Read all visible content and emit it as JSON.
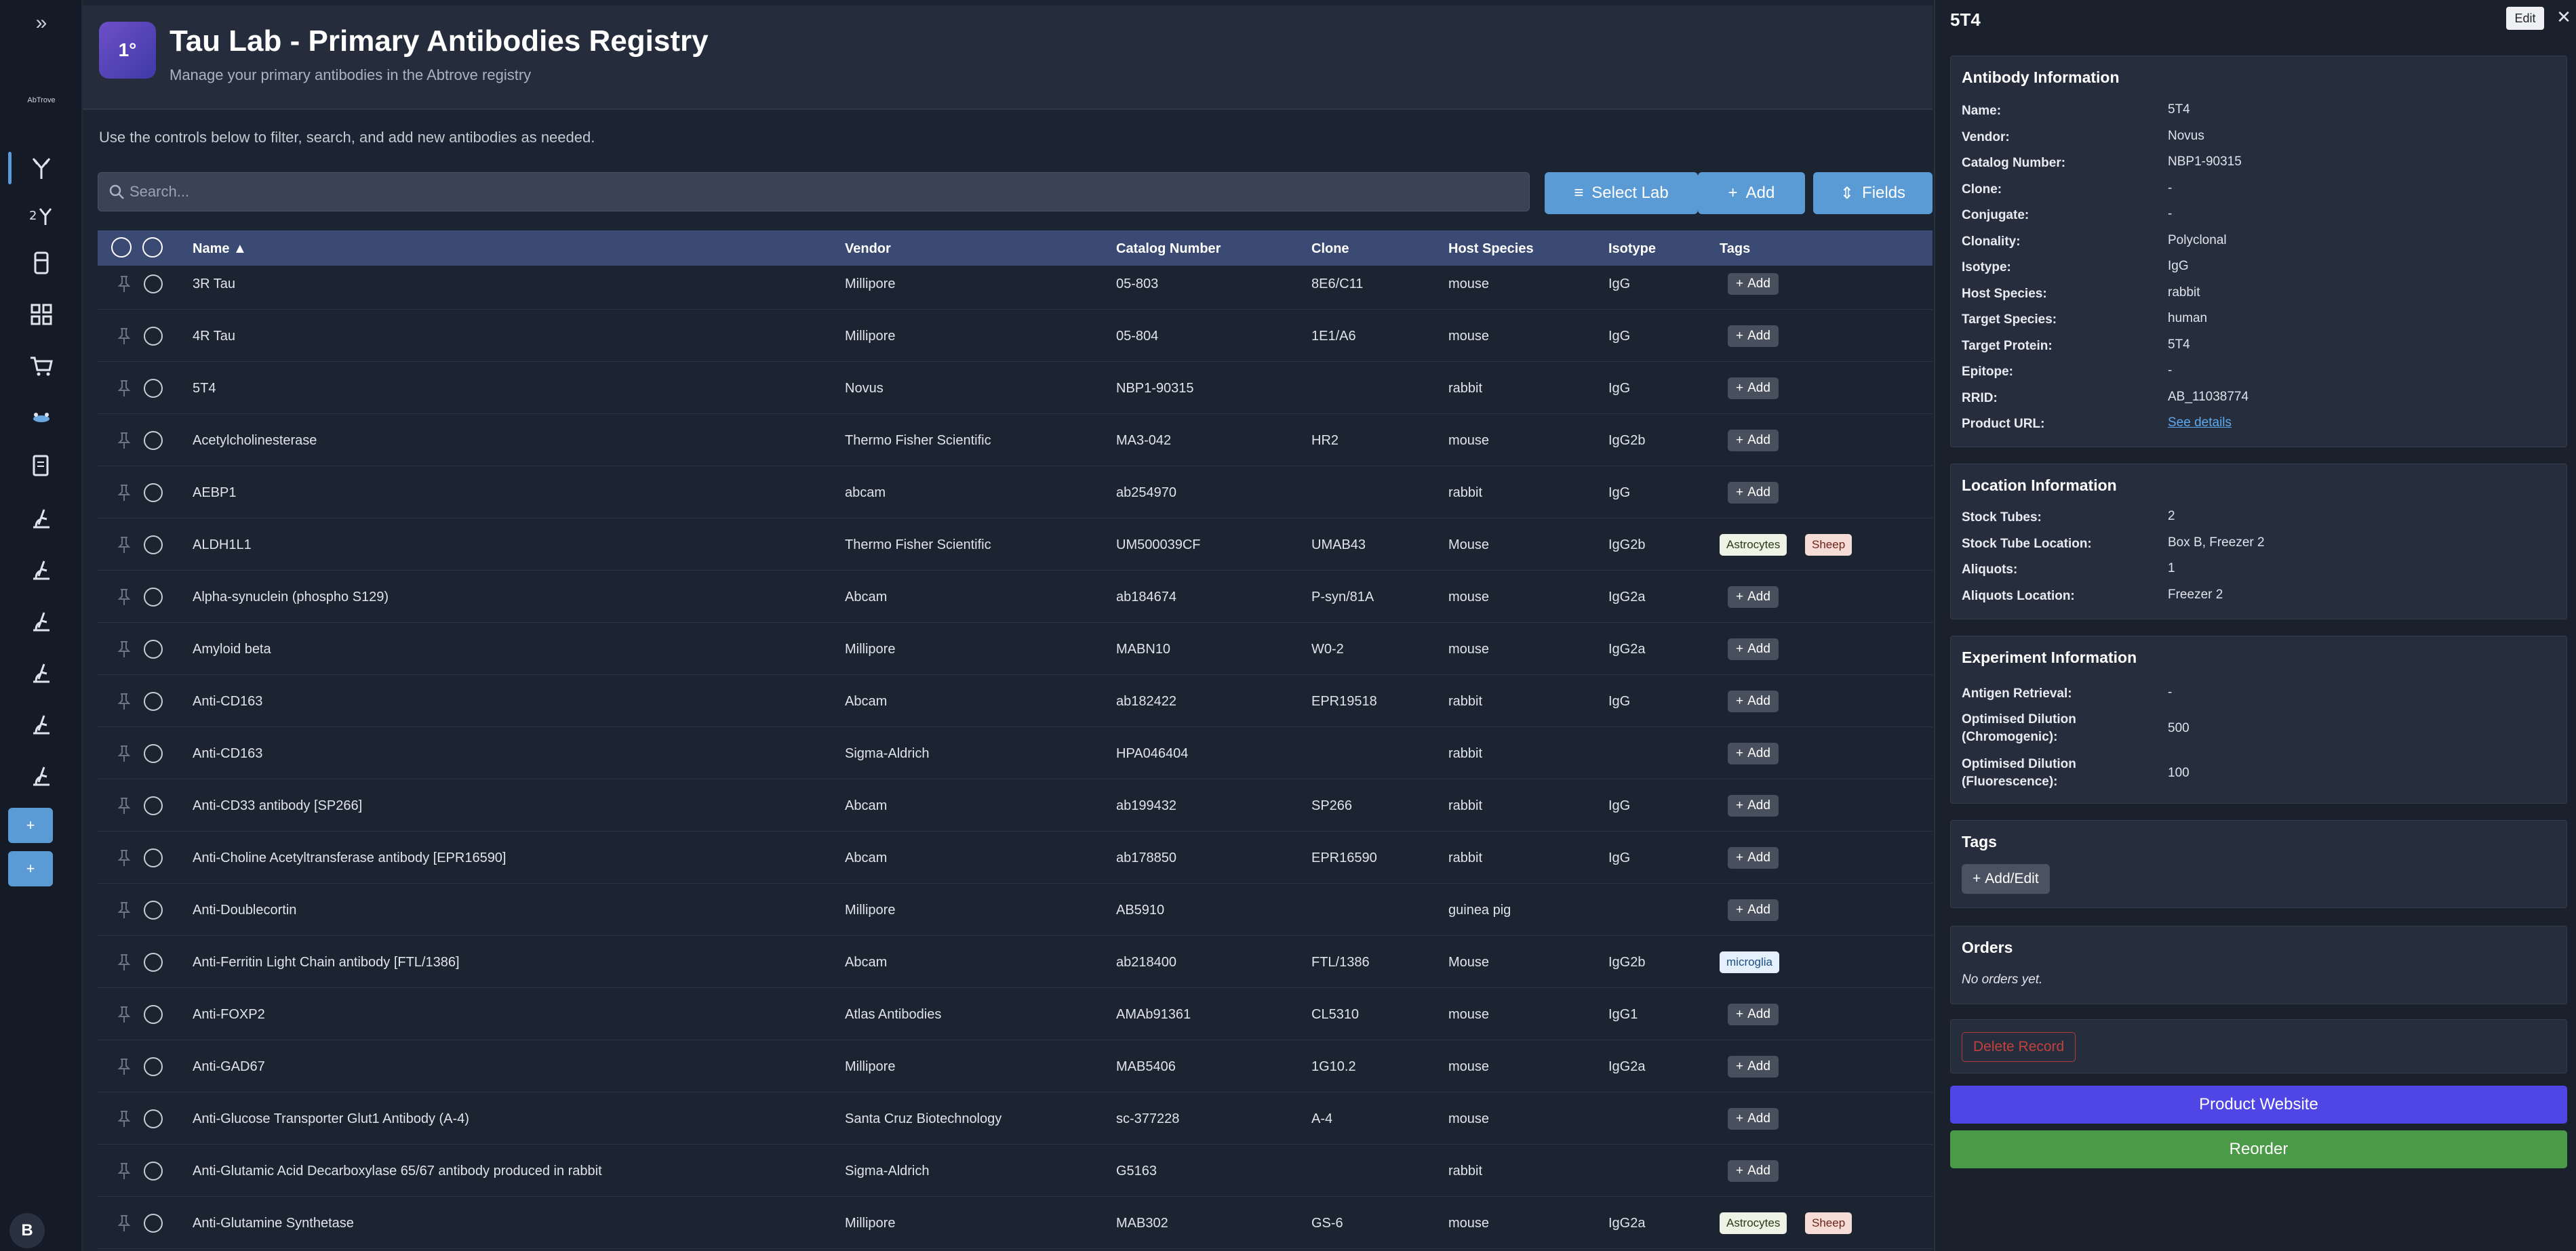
{
  "app": {
    "title": "Tau Lab - Primary Antibodies Registry",
    "subtitle": "Manage your primary antibodies in the Abtrove registry",
    "icon_text": "1°",
    "instructions": "Use the controls below to filter, search, and add new antibodies as needed."
  },
  "sidebar": {
    "expand_icon": "»",
    "logo_text": "AbTrove",
    "avatar": "B",
    "plus": "+"
  },
  "toolbar": {
    "search_placeholder": "Search...",
    "select_lab": "Select Lab",
    "add": "Add",
    "fields": "Fields"
  },
  "table": {
    "columns": [
      "Name ▲",
      "Vendor",
      "Catalog Number",
      "Clone",
      "Host Species",
      "Isotype",
      "Tags"
    ],
    "add_tag_label": "Add",
    "rows": [
      {
        "name": "3R Tau",
        "vendor": "Millipore",
        "catalog": "05-803",
        "clone": "8E6/C11",
        "host": "mouse",
        "isotype": "IgG",
        "tags": []
      },
      {
        "name": "4R Tau",
        "vendor": "Millipore",
        "catalog": "05-804",
        "clone": "1E1/A6",
        "host": "mouse",
        "isotype": "IgG",
        "tags": []
      },
      {
        "name": "5T4",
        "vendor": "Novus",
        "catalog": "NBP1-90315",
        "clone": "",
        "host": "rabbit",
        "isotype": "IgG",
        "tags": []
      },
      {
        "name": "Acetylcholinesterase",
        "vendor": "Thermo Fisher Scientific",
        "catalog": "MA3-042",
        "clone": "HR2",
        "host": "mouse",
        "isotype": "IgG2b",
        "tags": []
      },
      {
        "name": "AEBP1",
        "vendor": "abcam",
        "catalog": "ab254970",
        "clone": "",
        "host": "rabbit",
        "isotype": "IgG",
        "tags": []
      },
      {
        "name": "ALDH1L1",
        "vendor": "Thermo Fisher Scientific",
        "catalog": "UM500039CF",
        "clone": "UMAB43",
        "host": "Mouse",
        "isotype": "IgG2b",
        "tags": [
          "Astrocytes",
          "Sheep"
        ]
      },
      {
        "name": "Alpha-synuclein (phospho S129)",
        "vendor": "Abcam",
        "catalog": "ab184674",
        "clone": "P-syn/81A",
        "host": "mouse",
        "isotype": "IgG2a",
        "tags": []
      },
      {
        "name": "Amyloid beta",
        "vendor": "Millipore",
        "catalog": "MABN10",
        "clone": "W0-2",
        "host": "mouse",
        "isotype": "IgG2a",
        "tags": []
      },
      {
        "name": "Anti-CD163",
        "vendor": "Abcam",
        "catalog": "ab182422",
        "clone": "EPR19518",
        "host": "rabbit",
        "isotype": "IgG",
        "tags": []
      },
      {
        "name": "Anti-CD163",
        "vendor": "Sigma-Aldrich",
        "catalog": "HPA046404",
        "clone": "",
        "host": "rabbit",
        "isotype": "",
        "tags": []
      },
      {
        "name": "Anti-CD33 antibody [SP266]",
        "vendor": "Abcam",
        "catalog": "ab199432",
        "clone": "SP266",
        "host": "rabbit",
        "isotype": "IgG",
        "tags": []
      },
      {
        "name": "Anti-Choline Acetyltransferase antibody [EPR16590]",
        "vendor": "Abcam",
        "catalog": "ab178850",
        "clone": "EPR16590",
        "host": "rabbit",
        "isotype": "IgG",
        "tags": []
      },
      {
        "name": "Anti-Doublecortin",
        "vendor": "Millipore",
        "catalog": "AB5910",
        "clone": "",
        "host": "guinea pig",
        "isotype": "",
        "tags": []
      },
      {
        "name": "Anti-Ferritin Light Chain antibody [FTL/1386]",
        "vendor": "Abcam",
        "catalog": "ab218400",
        "clone": "FTL/1386",
        "host": "Mouse",
        "isotype": "IgG2b",
        "tags": [
          "microglia"
        ]
      },
      {
        "name": "Anti-FOXP2",
        "vendor": "Atlas Antibodies",
        "catalog": "AMAb91361",
        "clone": "CL5310",
        "host": "mouse",
        "isotype": "IgG1",
        "tags": []
      },
      {
        "name": "Anti-GAD67",
        "vendor": "Millipore",
        "catalog": "MAB5406",
        "clone": "1G10.2",
        "host": "mouse",
        "isotype": "IgG2a",
        "tags": []
      },
      {
        "name": "Anti-Glucose Transporter Glut1 Antibody (A-4)",
        "vendor": "Santa Cruz Biotechnology",
        "catalog": "sc-377228",
        "clone": "A-4",
        "host": "mouse",
        "isotype": "",
        "tags": []
      },
      {
        "name": "Anti-Glutamic Acid Decarboxylase 65/67 antibody produced in rabbit",
        "vendor": "Sigma-Aldrich",
        "catalog": "G5163",
        "clone": "",
        "host": "rabbit",
        "isotype": "",
        "tags": []
      },
      {
        "name": "Anti-Glutamine Synthetase",
        "vendor": "Millipore",
        "catalog": "MAB302",
        "clone": "GS-6",
        "host": "mouse",
        "isotype": "IgG2a",
        "tags": [
          "Astrocytes",
          "Sheep"
        ]
      }
    ]
  },
  "tag_colors": {
    "Astrocytes": {
      "bg": "#eef3e6",
      "fg": "#2a3a1a"
    },
    "Sheep": {
      "bg": "#f6dcd6",
      "fg": "#6a2418"
    },
    "microglia": {
      "bg": "#e4f0fb",
      "fg": "#1d4d80"
    }
  },
  "panel": {
    "title": "5T4",
    "edit": "Edit",
    "close": "✕",
    "antibody_info": {
      "title": "Antibody Information",
      "fields": [
        {
          "label": "Name:",
          "value": "5T4"
        },
        {
          "label": "Vendor:",
          "value": "Novus"
        },
        {
          "label": "Catalog Number:",
          "value": "NBP1-90315"
        },
        {
          "label": "Clone:",
          "value": "-"
        },
        {
          "label": "Conjugate:",
          "value": "-"
        },
        {
          "label": "Clonality:",
          "value": "Polyclonal"
        },
        {
          "label": "Isotype:",
          "value": "IgG"
        },
        {
          "label": "Host Species:",
          "value": "rabbit"
        },
        {
          "label": "Target Species:",
          "value": "human"
        },
        {
          "label": "Target Protein:",
          "value": "5T4"
        },
        {
          "label": "Epitope:",
          "value": "-"
        },
        {
          "label": "RRID:",
          "value": "AB_11038774"
        },
        {
          "label": "Product URL:",
          "value": "See details"
        }
      ]
    },
    "location_info": {
      "title": "Location Information",
      "fields": [
        {
          "label": "Stock Tubes:",
          "value": "2"
        },
        {
          "label": "Stock Tube Location:",
          "value": "Box B, Freezer 2"
        },
        {
          "label": "Aliquots:",
          "value": "1"
        },
        {
          "label": "Aliquots Location:",
          "value": "Freezer 2"
        }
      ]
    },
    "experiment_info": {
      "title": "Experiment Information",
      "fields": [
        {
          "label": "Antigen Retrieval:",
          "value": "-"
        },
        {
          "label": "Optimised Dilution (Chromogenic):",
          "value": "500"
        },
        {
          "label": "Optimised Dilution (Fluorescence):",
          "value": "100"
        }
      ]
    },
    "tags": {
      "title": "Tags",
      "button": "Add/Edit"
    },
    "orders": {
      "title": "Orders",
      "empty": "No orders yet."
    },
    "delete": "Delete Record",
    "product_website": "Product Website",
    "reorder": "Reorder",
    "colors": {
      "product_website": "#4f46e5",
      "reorder": "#4a9a48",
      "delete": "#c4403f"
    }
  }
}
